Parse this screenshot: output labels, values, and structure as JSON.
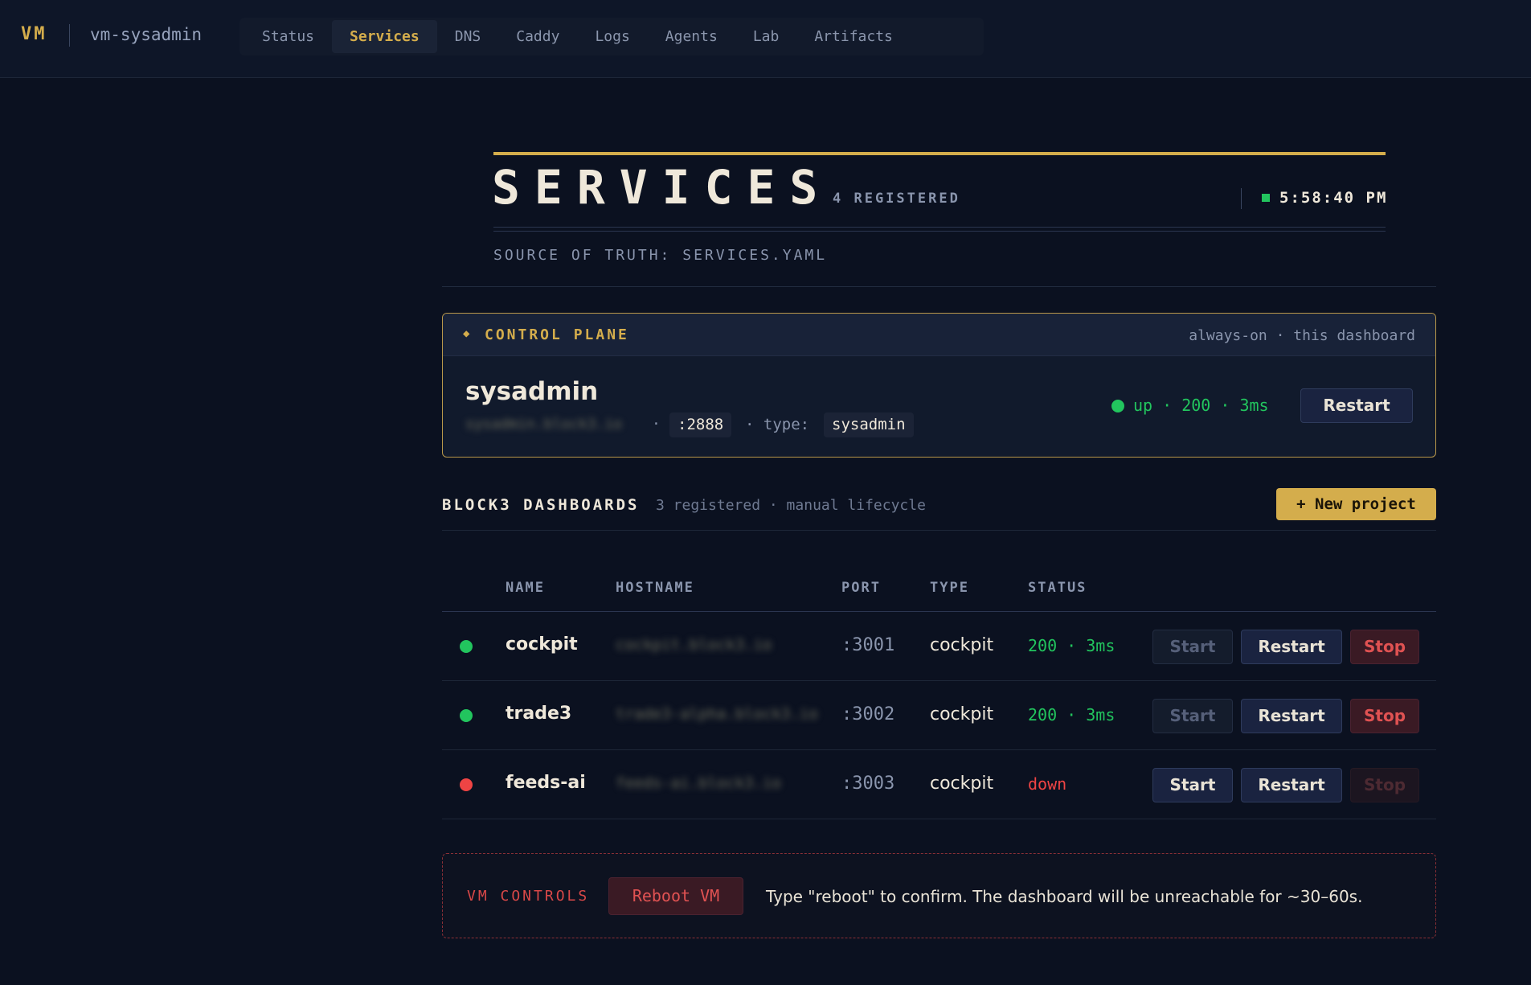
{
  "topbar": {
    "brand": "VM",
    "hostname": "vm-sysadmin",
    "tabs": [
      {
        "label": "Status"
      },
      {
        "label": "Services",
        "active": true
      },
      {
        "label": "DNS"
      },
      {
        "label": "Caddy"
      },
      {
        "label": "Logs"
      },
      {
        "label": "Agents"
      },
      {
        "label": "Lab"
      },
      {
        "label": "Artifacts"
      }
    ]
  },
  "header": {
    "title": "SERVICES",
    "registered": "4 REGISTERED",
    "clock": "5:58:40 PM",
    "source": "SOURCE OF TRUTH: SERVICES.YAML"
  },
  "control_plane": {
    "title": "CONTROL PLANE",
    "meta": "always-on · this dashboard",
    "name": "sysadmin",
    "hostname": "sysadmin.block3.io",
    "separator": "·",
    "port": ":2888",
    "type_label": "· type:",
    "type": "sysadmin",
    "status": "up · 200 · 3ms",
    "restart_label": "Restart"
  },
  "dashboards": {
    "title": "BLOCK3 DASHBOARDS",
    "meta": "3 registered · manual lifecycle",
    "new_project_label": "+ New project",
    "columns": {
      "name": "NAME",
      "hostname": "HOSTNAME",
      "port": "PORT",
      "type": "TYPE",
      "status": "STATUS"
    },
    "rows": [
      {
        "name": "cockpit",
        "hostname": "cockpit.block3.io",
        "port": ":3001",
        "type": "cockpit",
        "status": "200 · 3ms",
        "state": "up",
        "start": "Start",
        "restart": "Restart",
        "stop": "Stop"
      },
      {
        "name": "trade3",
        "hostname": "trade3-alpha.block3.io",
        "port": ":3002",
        "type": "cockpit",
        "status": "200 · 3ms",
        "state": "up",
        "start": "Start",
        "restart": "Restart",
        "stop": "Stop"
      },
      {
        "name": "feeds-ai",
        "hostname": "feeds-ai.block3.io",
        "port": ":3003",
        "type": "cockpit",
        "status": "down",
        "state": "down",
        "start": "Start",
        "restart": "Restart",
        "stop": "Stop"
      }
    ]
  },
  "vm_controls": {
    "title": "VM CONTROLS",
    "reboot_label": "Reboot VM",
    "note": "Type \"reboot\" to confirm. The dashboard will be unreachable for ~30–60s."
  },
  "colors": {
    "accent": "#d4ad4c",
    "up": "#22c55e",
    "down": "#ef4444",
    "background": "#0b1120"
  }
}
